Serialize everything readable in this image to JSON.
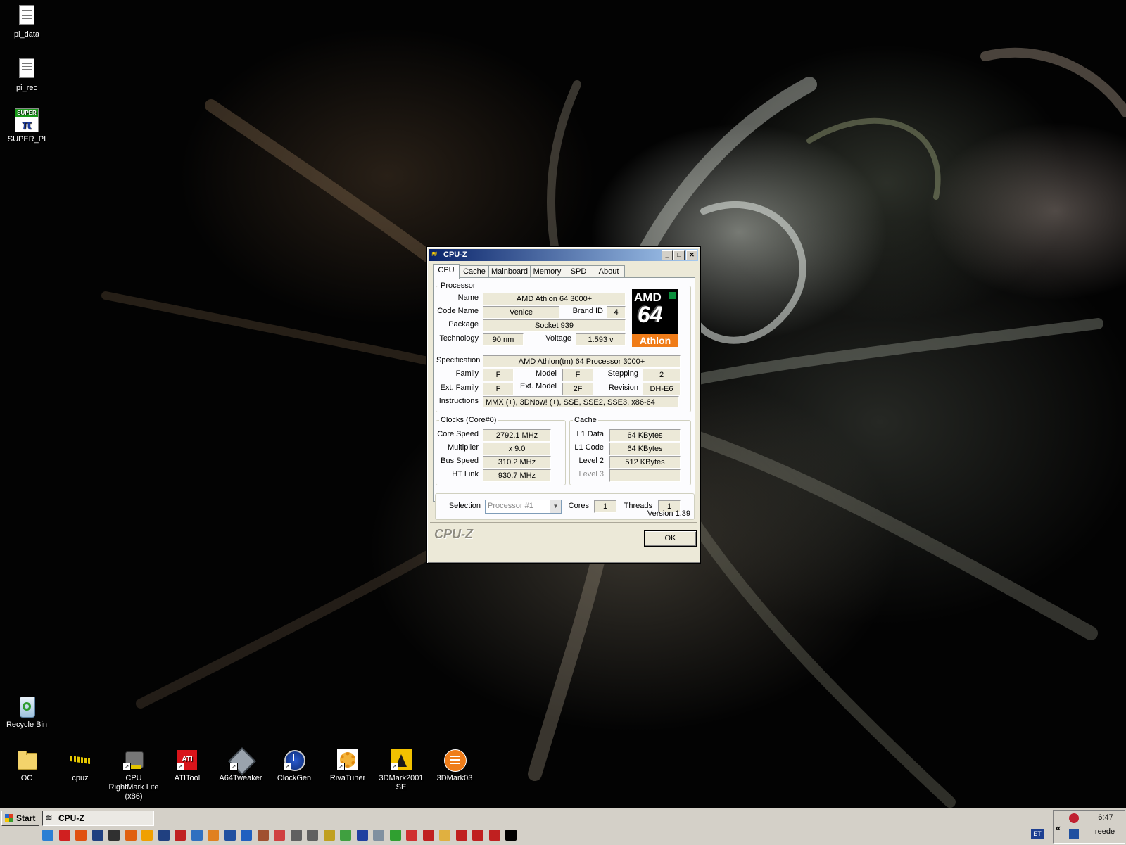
{
  "desktop": {
    "top_icons": [
      {
        "label": "pi_data",
        "icon": "text-document-icon"
      },
      {
        "label": "pi_rec",
        "icon": "text-document-icon"
      },
      {
        "label": "SUPER_PI",
        "icon": "super-pi-icon"
      }
    ],
    "recycle_bin": {
      "label": "Recycle Bin",
      "icon": "recycle-bin-icon"
    },
    "bottom_icons": [
      {
        "label": "OC",
        "icon": "folder-icon"
      },
      {
        "label": "cpuz",
        "icon": "cpuz-icon"
      },
      {
        "label": "CPU RightMark Lite (x86)",
        "icon": "cpu-rightmark-icon"
      },
      {
        "label": "ATITool",
        "icon": "atitool-icon"
      },
      {
        "label": "A64Tweaker",
        "icon": "a64tweaker-icon"
      },
      {
        "label": "ClockGen",
        "icon": "clockgen-icon"
      },
      {
        "label": "RivaTuner",
        "icon": "rivatuner-icon"
      },
      {
        "label": "3DMark2001 SE",
        "icon": "3dmark2001-icon"
      },
      {
        "label": "3DMark03",
        "icon": "3dmark03-icon"
      }
    ]
  },
  "cpuz": {
    "title": "CPU-Z",
    "title_buttons": {
      "minimize": "_",
      "maximize": "□",
      "close": "✕"
    },
    "tabs": [
      "CPU",
      "Cache",
      "Mainboard",
      "Memory",
      "SPD",
      "About"
    ],
    "active_tab": "CPU",
    "processor": {
      "group_label": "Processor",
      "labels": {
        "name": "Name",
        "code_name": "Code Name",
        "brand_id": "Brand ID",
        "package": "Package",
        "technology": "Technology",
        "voltage": "Voltage",
        "specification": "Specification",
        "family": "Family",
        "model": "Model",
        "stepping": "Stepping",
        "ext_family": "Ext. Family",
        "ext_model": "Ext. Model",
        "revision": "Revision",
        "instructions": "Instructions"
      },
      "values": {
        "name": "AMD Athlon 64 3000+",
        "code_name": "Venice",
        "brand_id": "4",
        "package": "Socket 939",
        "technology": "90 nm",
        "voltage": "1.593 v",
        "specification": "AMD Athlon(tm) 64 Processor 3000+",
        "family": "F",
        "model": "F",
        "stepping": "2",
        "ext_family": "F",
        "ext_model": "2F",
        "revision": "DH-E6",
        "instructions": "MMX (+), 3DNow! (+), SSE, SSE2, SSE3, x86-64"
      },
      "logo": {
        "brand": "AMD",
        "number": "64",
        "line": "Athlon",
        "colors": {
          "bg": "#000000",
          "band": "#f07c18",
          "arrow": "#0a8f3c"
        }
      }
    },
    "clocks": {
      "group_label": "Clocks (Core#0)",
      "labels": {
        "core_speed": "Core Speed",
        "multiplier": "Multiplier",
        "bus_speed": "Bus Speed",
        "ht_link": "HT Link"
      },
      "values": {
        "core_speed": "2792.1 MHz",
        "multiplier": "x 9.0",
        "bus_speed": "310.2 MHz",
        "ht_link": "930.7 MHz"
      }
    },
    "cache": {
      "group_label": "Cache",
      "labels": {
        "l1_data": "L1 Data",
        "l1_code": "L1 Code",
        "level2": "Level 2",
        "level3": "Level 3"
      },
      "values": {
        "l1_data": "64 KBytes",
        "l1_code": "64 KBytes",
        "level2": "512 KBytes",
        "level3": ""
      }
    },
    "selection": {
      "label": "Selection",
      "value": "Processor #1",
      "cores_label": "Cores",
      "cores": "1",
      "threads_label": "Threads",
      "threads": "1"
    },
    "version": "Version 1.39",
    "brand_text": "CPU-Z",
    "ok_label": "OK"
  },
  "taskbar": {
    "start_label": "Start",
    "active_task": "CPU-Z",
    "quick_launch_colors": [
      "#2a7fd4",
      "#d02020",
      "#e05010",
      "#204080",
      "#303030",
      "#e06010",
      "#f0a000",
      "#204080",
      "#c02020",
      "#3070c0",
      "#e08020",
      "#2050a0",
      "#2060c0",
      "#a05030",
      "#d04040",
      "#606060",
      "#606060",
      "#c0a020",
      "#40a040",
      "#2040a0",
      "#8090a0",
      "#30a030",
      "#d03030",
      "#c02020",
      "#e0b040",
      "#c02020",
      "#c02020",
      "#c02020",
      "#000000"
    ],
    "language": "ET",
    "clock": "6:47",
    "day": "reede",
    "tray_chevron": "«"
  }
}
